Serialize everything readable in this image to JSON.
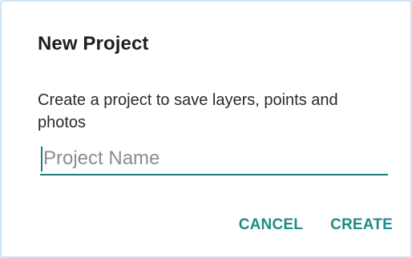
{
  "dialog": {
    "title": "New Project",
    "message": "Create a project to save layers, points and photos",
    "project_name": {
      "value": "",
      "placeholder": "Project Name"
    },
    "actions": {
      "cancel_label": "CANCEL",
      "create_label": "CREATE"
    }
  },
  "colors": {
    "accent": "#1f8b85",
    "underline": "#1d7b85",
    "title": "#1f1f1f",
    "placeholder": "#8c8c8c",
    "frame_border": "#cfe1f5"
  }
}
